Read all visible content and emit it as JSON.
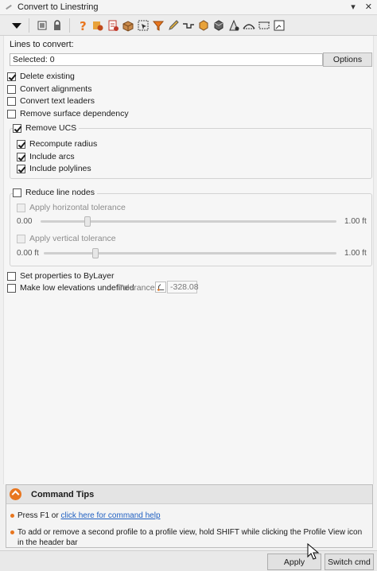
{
  "window": {
    "title": "Convert to Linestring"
  },
  "title_controls": [
    "▾",
    "✕"
  ],
  "toolbar_icons": [
    "dropdown-arrow-icon",
    "select-icon",
    "lock-icon",
    "help-icon",
    "settings-icon",
    "convert-icon",
    "box-icon",
    "select-window-icon",
    "funnel-icon",
    "pencil-icon",
    "line-icon",
    "cube-icon",
    "solid-icon",
    "triangle-icon",
    "arc-icon",
    "dashed-box-icon",
    "window-icon"
  ],
  "lines_to_convert": {
    "label": "Lines to convert:",
    "selected": "Selected: 0",
    "options_label": "Options"
  },
  "options": [
    {
      "label": "Delete existing",
      "checked": true
    },
    {
      "label": "Convert alignments",
      "checked": false
    },
    {
      "label": "Convert text leaders",
      "checked": false
    },
    {
      "label": "Remove surface dependency",
      "checked": false
    }
  ],
  "remove_ucs": {
    "label": "Remove UCS",
    "checked": true,
    "items": [
      {
        "label": "Recompute radius",
        "checked": true
      },
      {
        "label": "Include arcs",
        "checked": true
      },
      {
        "label": "Include polylines",
        "checked": true
      }
    ]
  },
  "reduce_nodes": {
    "label": "Reduce line nodes",
    "checked": false,
    "horizontal": {
      "label": "Apply horizontal tolerance",
      "min": "0.00",
      "max": "1.00 ft",
      "fraction": 0.15
    },
    "vertical": {
      "label": "Apply vertical tolerance",
      "min": "0.00 ft",
      "max": "1.00 ft",
      "fraction": 0.17
    }
  },
  "set_bylayer": {
    "label": "Set properties to ByLayer",
    "checked": false
  },
  "low_elev": {
    "label": "Make low elevations undefined",
    "checked": false,
    "tolerance_label": "Tolerance:",
    "tolerance_value": "-328.08"
  },
  "command_tips": {
    "title": "Command Tips",
    "tip1_prefix": "Press F1 or ",
    "tip1_link": "click here for command help",
    "tip2": "To add or remove a second profile to a profile view, hold SHIFT while clicking the Profile View icon in the header bar"
  },
  "buttons": {
    "apply": "Apply",
    "switch_cmd": "Switch cmd"
  },
  "colors": {
    "accent": "#e8761f",
    "link": "#1f5fc1"
  }
}
